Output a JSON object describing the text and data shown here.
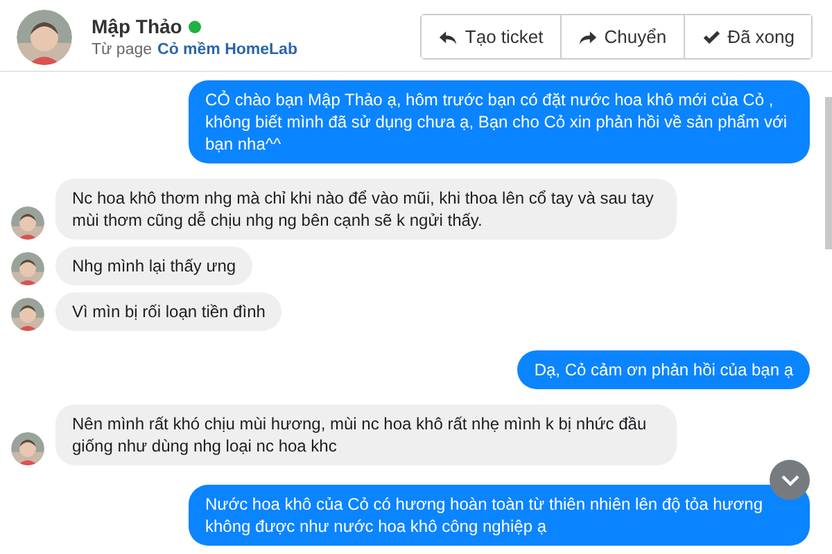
{
  "contact": {
    "name": "Mập Thảo",
    "online": true,
    "source_prefix": "Từ page",
    "source_page": "Cỏ mềm HomeLab"
  },
  "actions": [
    {
      "label": "Tạo ticket",
      "kind": "reply"
    },
    {
      "label": "Chuyển",
      "kind": "forward"
    },
    {
      "label": "Đã xong",
      "kind": "done"
    }
  ],
  "messages": [
    {
      "kind": "sent",
      "text": "CỎ chào bạn Mập Thảo ạ, hôm trước bạn có đặt nước hoa khô mới của Cỏ , không biết mình đã sử dụng chưa ạ, Bạn cho Cỏ xin phản hồi về sản phẩm với bạn nha^^"
    },
    {
      "kind": "received",
      "text": "Nc hoa khô thơm nhg mà chỉ khi nào để vào mũi, khi thoa lên cổ tay và sau tay mùi thơm cũng dễ chịu nhg ng bên cạnh sẽ k ngửi thấy."
    },
    {
      "kind": "received",
      "text": "Nhg mình lại thấy ưng"
    },
    {
      "kind": "received",
      "text": "Vì mìn bị rối loạn tiền đình"
    },
    {
      "kind": "sent",
      "text": "Dạ, Cỏ cảm ơn phản hồi của bạn ạ"
    },
    {
      "kind": "received",
      "text": "Nên mình rất khó chịu mùi hương, mùi nc hoa khô rất nhẹ mình k bị nhức đầu giống như dùng nhg loại nc hoa khc"
    },
    {
      "kind": "sent",
      "text": "Nước hoa khô của Cỏ có hương hoàn toàn từ thiên nhiên lên độ tỏa hương không được như nước hoa khô công nghiệp ạ"
    }
  ]
}
